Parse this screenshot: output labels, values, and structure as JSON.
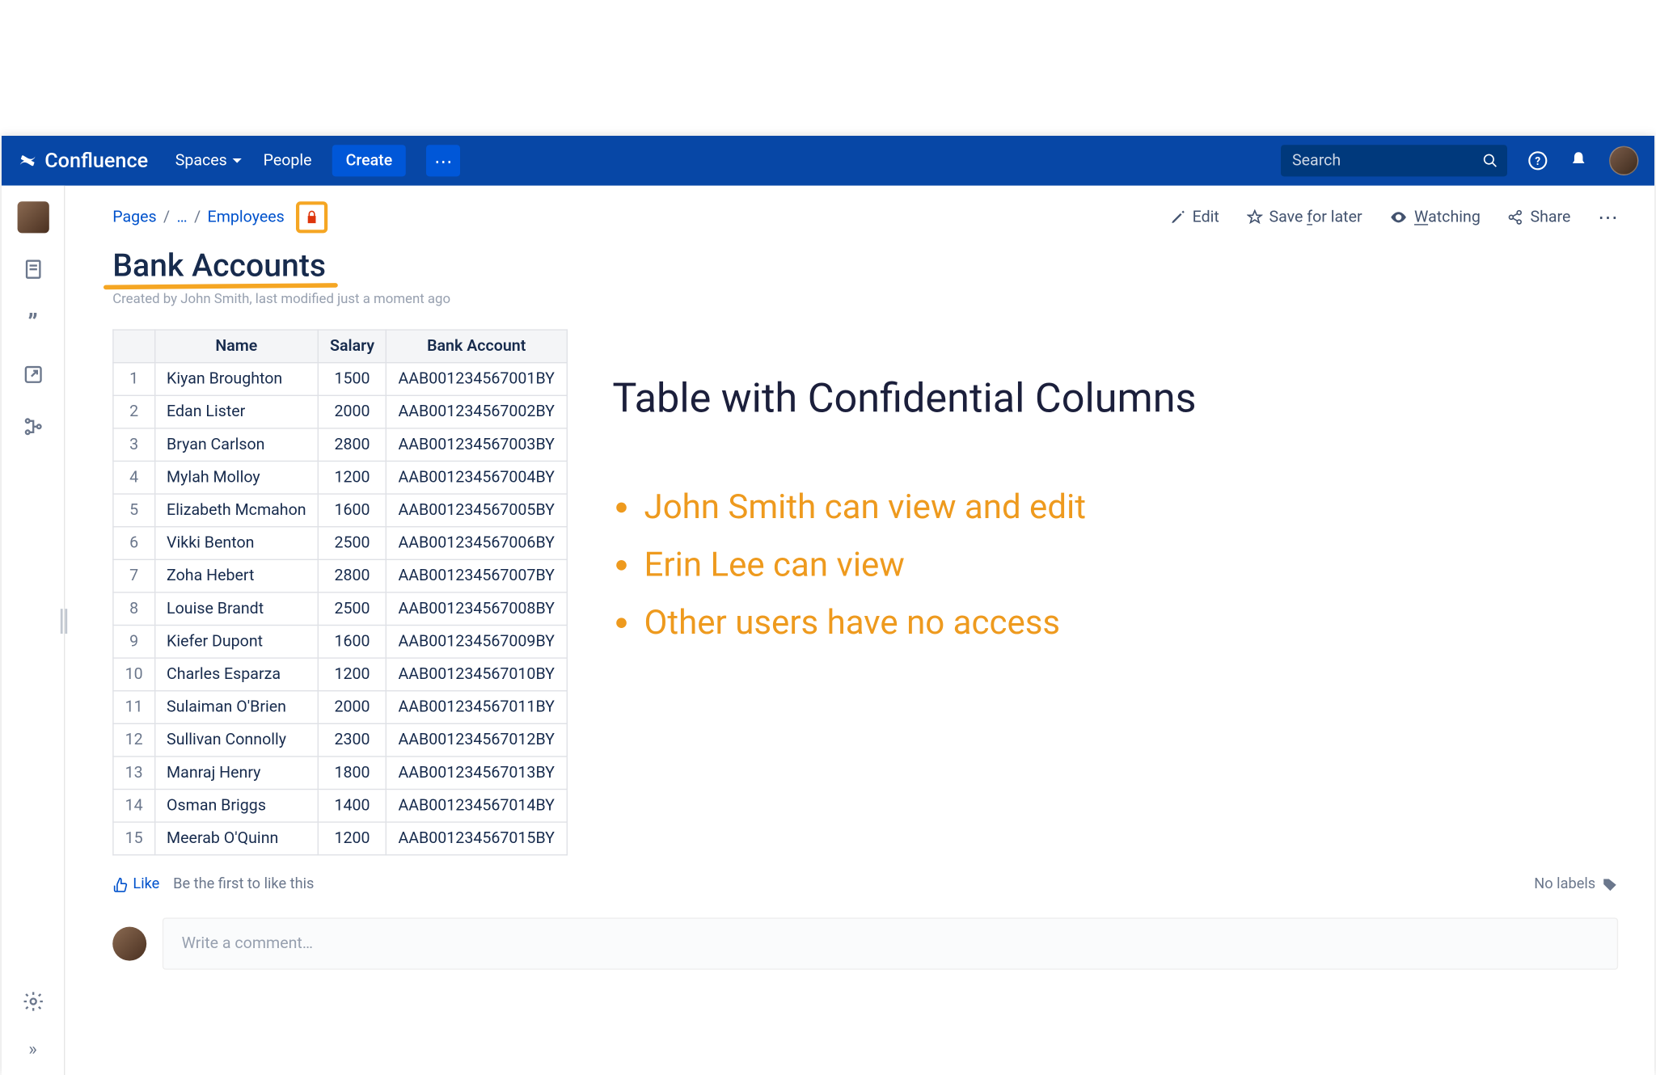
{
  "app_name": "Confluence",
  "nav": {
    "spaces": "Spaces",
    "people": "People",
    "create": "Create"
  },
  "search_placeholder": "Search",
  "breadcrumb": {
    "pages": "Pages",
    "sep": "/",
    "ellipsis": "…",
    "employees": "Employees"
  },
  "actions": {
    "edit": "Edit",
    "save": "Save for later",
    "watching": "Watching",
    "share": "Share"
  },
  "page_title": "Bank Accounts",
  "meta_text": "Created by John Smith, last modified just a moment ago",
  "table": {
    "headers": {
      "rownum": "",
      "name": "Name",
      "salary": "Salary",
      "account": "Bank Account"
    },
    "rows": [
      {
        "n": "1",
        "name": "Kiyan Broughton",
        "salary": "1500",
        "account": "AAB001234567001BY"
      },
      {
        "n": "2",
        "name": "Edan Lister",
        "salary": "2000",
        "account": "AAB001234567002BY"
      },
      {
        "n": "3",
        "name": "Bryan Carlson",
        "salary": "2800",
        "account": "AAB001234567003BY"
      },
      {
        "n": "4",
        "name": "Mylah Molloy",
        "salary": "1200",
        "account": "AAB001234567004BY"
      },
      {
        "n": "5",
        "name": "Elizabeth Mcmahon",
        "salary": "1600",
        "account": "AAB001234567005BY"
      },
      {
        "n": "6",
        "name": "Vikki Benton",
        "salary": "2500",
        "account": "AAB001234567006BY"
      },
      {
        "n": "7",
        "name": "Zoha Hebert",
        "salary": "2800",
        "account": "AAB001234567007BY"
      },
      {
        "n": "8",
        "name": "Louise Brandt",
        "salary": "2500",
        "account": "AAB001234567008BY"
      },
      {
        "n": "9",
        "name": "Kiefer Dupont",
        "salary": "1600",
        "account": "AAB001234567009BY"
      },
      {
        "n": "10",
        "name": "Charles Esparza",
        "salary": "1200",
        "account": "AAB001234567010BY"
      },
      {
        "n": "11",
        "name": "Sulaiman O'Brien",
        "salary": "2000",
        "account": "AAB001234567011BY"
      },
      {
        "n": "12",
        "name": "Sullivan Connolly",
        "salary": "2300",
        "account": "AAB001234567012BY"
      },
      {
        "n": "13",
        "name": "Manraj Henry",
        "salary": "1800",
        "account": "AAB001234567013BY"
      },
      {
        "n": "14",
        "name": "Osman Briggs",
        "salary": "1400",
        "account": "AAB001234567014BY"
      },
      {
        "n": "15",
        "name": "Meerab O'Quinn",
        "salary": "1200",
        "account": "AAB001234567015BY"
      }
    ]
  },
  "annotation": {
    "title": "Table with Confidential Columns",
    "bullets": [
      "John Smith can view and edit",
      "Erin Lee can view",
      "Other users have no access"
    ]
  },
  "footer": {
    "like": "Like",
    "be_first": "Be the first to like this",
    "no_labels": "No labels"
  },
  "comment_placeholder": "Write a comment…"
}
